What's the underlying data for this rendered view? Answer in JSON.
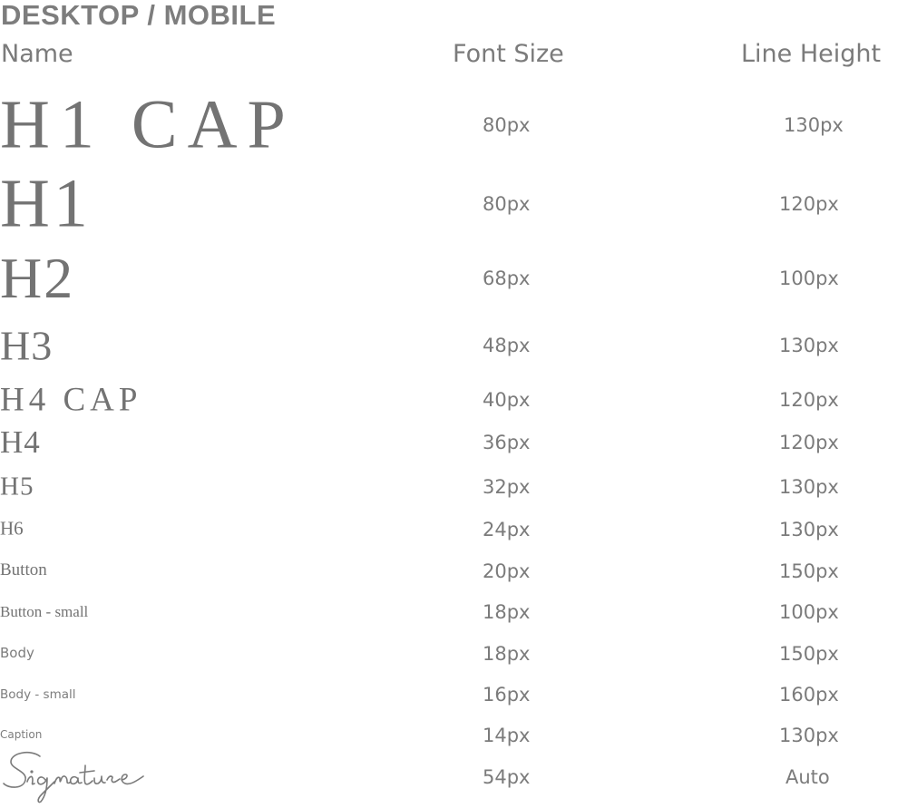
{
  "section_title": "DESKTOP / MOBILE",
  "headers": {
    "name": "Name",
    "font_size": "Font Size",
    "line_height": "Line Height"
  },
  "rows": [
    {
      "name": "H1 CAP",
      "font_size": "80px",
      "line_height": "130px"
    },
    {
      "name": "H1",
      "font_size": "80px",
      "line_height": "120px"
    },
    {
      "name": "H2",
      "font_size": "68px",
      "line_height": "100px"
    },
    {
      "name": "H3",
      "font_size": "48px",
      "line_height": "130px"
    },
    {
      "name": "H4 CAP",
      "font_size": "40px",
      "line_height": "120px"
    },
    {
      "name": "H4",
      "font_size": "36px",
      "line_height": "120px"
    },
    {
      "name": "H5",
      "font_size": "32px",
      "line_height": "130px"
    },
    {
      "name": "H6",
      "font_size": "24px",
      "line_height": "130px"
    },
    {
      "name": "Button",
      "font_size": "20px",
      "line_height": "150px"
    },
    {
      "name": "Button - small",
      "font_size": "18px",
      "line_height": "100px"
    },
    {
      "name": "Body",
      "font_size": "18px",
      "line_height": "150px"
    },
    {
      "name": "Body - small",
      "font_size": "16px",
      "line_height": "160px"
    },
    {
      "name": "Caption",
      "font_size": "14px",
      "line_height": "130px"
    },
    {
      "name": "Signature",
      "font_size": "54px",
      "line_height": "Auto"
    }
  ]
}
